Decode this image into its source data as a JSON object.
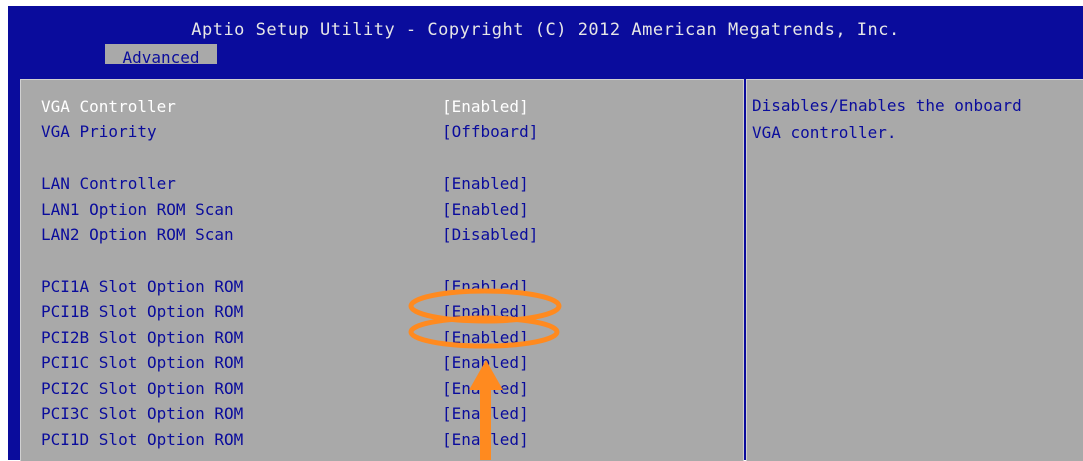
{
  "header": {
    "title": "Aptio Setup Utility - Copyright (C) 2012 American Megatrends, Inc.",
    "active_tab": "Advanced"
  },
  "settings": [
    {
      "label": "VGA Controller",
      "value": "[Enabled]",
      "selected": true
    },
    {
      "label": "VGA Priority",
      "value": "[Offboard]"
    },
    {
      "label": "LAN Controller",
      "value": "[Enabled]"
    },
    {
      "label": "LAN1 Option ROM Scan",
      "value": "[Enabled]"
    },
    {
      "label": "LAN2 Option ROM Scan",
      "value": "[Disabled]"
    },
    {
      "label": "PCI1A Slot Option ROM",
      "value": "[Enabled]"
    },
    {
      "label": "PCI1B Slot Option ROM",
      "value": "[Enabled]",
      "highlighted": true
    },
    {
      "label": "PCI2B Slot Option ROM",
      "value": "[Enabled]",
      "highlighted": true
    },
    {
      "label": "PCI1C Slot Option ROM",
      "value": "[Enabled]"
    },
    {
      "label": "PCI2C Slot Option ROM",
      "value": "[Enabled]"
    },
    {
      "label": "PCI3C Slot Option ROM",
      "value": "[Enabled]"
    },
    {
      "label": "PCI1D Slot Option ROM",
      "value": "[Enabled]"
    }
  ],
  "help": {
    "text": "Disables/Enables the onboard\nVGA controller."
  },
  "annotation": {
    "color": "#ff8a1f",
    "shapes": [
      "ellipse",
      "ellipse",
      "arrow-up-icon"
    ]
  }
}
